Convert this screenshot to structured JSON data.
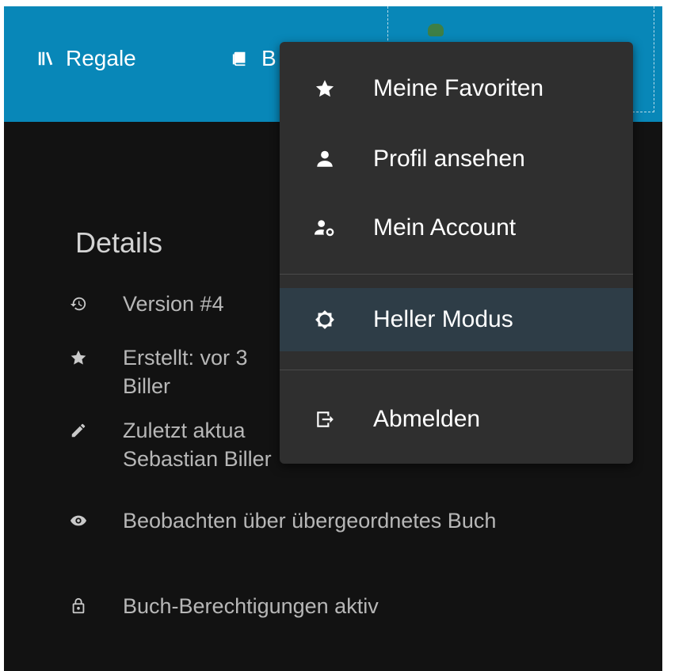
{
  "header": {
    "nav": [
      {
        "label": "Regale",
        "icon": "shelves-icon"
      },
      {
        "label": "B",
        "icon": "books-icon"
      }
    ],
    "brand_color": "#0887b8"
  },
  "details": {
    "title": "Details",
    "items": [
      {
        "icon": "history-icon",
        "text": "Version #4"
      },
      {
        "icon": "star-icon",
        "text": "Erstellt: vor 3\nBiller"
      },
      {
        "icon": "pencil-icon",
        "text": "Zuletzt aktua\nSebastian Biller"
      },
      {
        "icon": "eye-icon",
        "text": "Beobachten über übergeordnetes Buch"
      },
      {
        "icon": "lock-icon",
        "text": "Buch-Berechtigungen aktiv"
      }
    ]
  },
  "user_menu": {
    "items": [
      {
        "label": "Meine Favoriten",
        "icon": "star-icon"
      },
      {
        "label": "Profil ansehen",
        "icon": "user-icon"
      },
      {
        "label": "Mein Account",
        "icon": "user-settings-icon"
      },
      {
        "label": "Heller Modus",
        "icon": "light-mode-icon",
        "highlighted": true
      },
      {
        "label": "Abmelden",
        "icon": "logout-icon"
      }
    ]
  }
}
